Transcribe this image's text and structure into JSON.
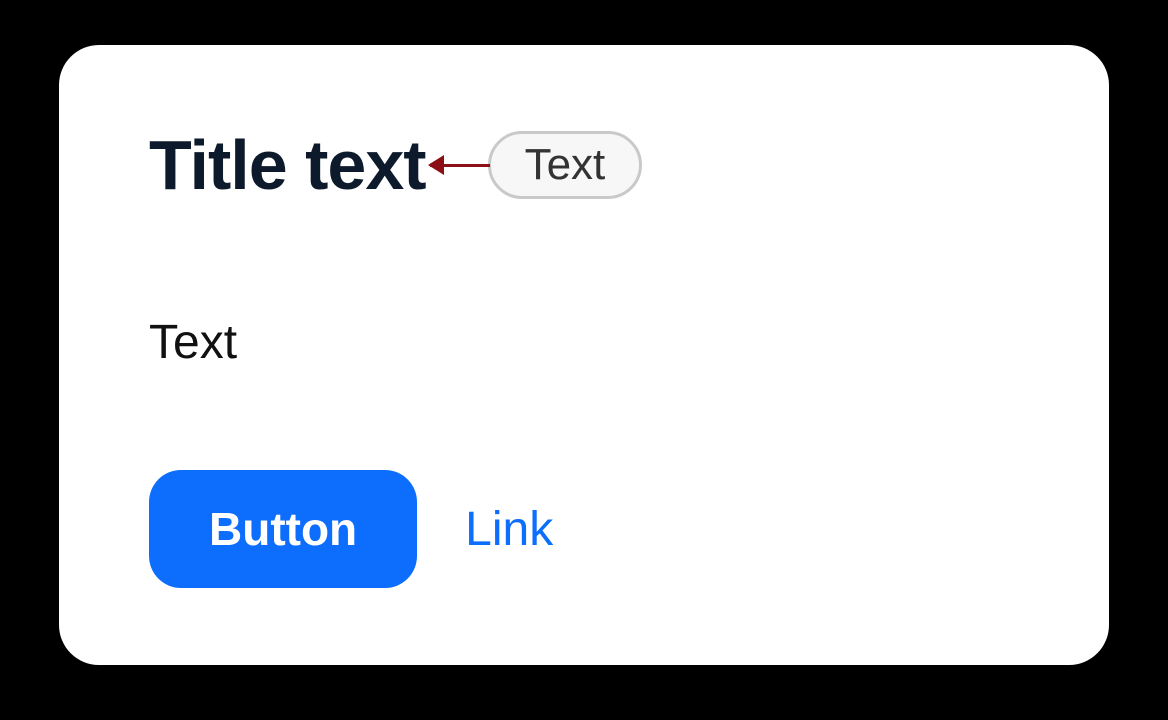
{
  "card": {
    "title": "Title text",
    "annotation_label": "Text",
    "body": "Text",
    "button_label": "Button",
    "link_label": "Link"
  }
}
